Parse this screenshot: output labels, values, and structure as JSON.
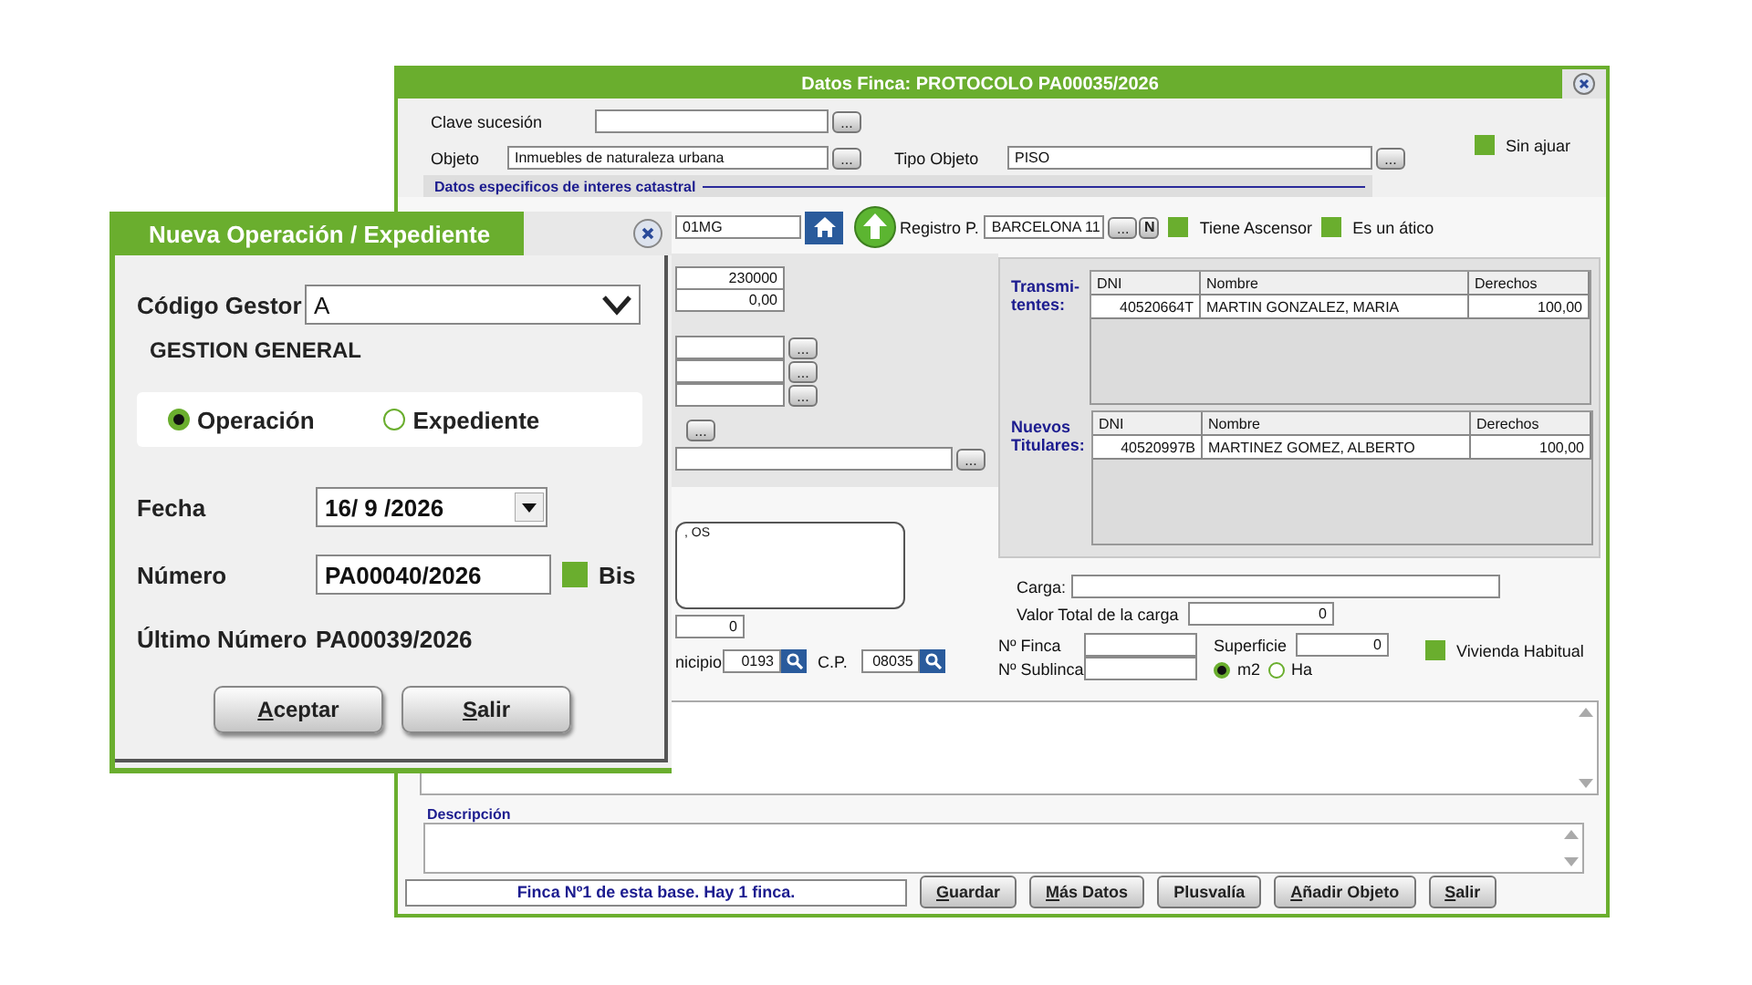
{
  "main_window": {
    "title": "Datos Finca: PROTOCOLO PA00035/2026",
    "clave_sucesion": {
      "label": "Clave sucesión",
      "button": "..."
    },
    "objeto": {
      "label": "Objeto",
      "value": "Inmuebles de naturaleza urbana",
      "button": "..."
    },
    "tipo_objeto": {
      "label": "Tipo Objeto",
      "value": "PISO",
      "button": "..."
    },
    "sin_ajuar": {
      "label": "Sin ajuar",
      "checked": false
    },
    "section_title": "Datos especificos de interes catastral",
    "ref_catastral": {
      "value": "01MG"
    },
    "registro": {
      "label": "Registro P.",
      "value": "BARCELONA 11",
      "button": "...",
      "n_button": "N"
    },
    "checks": [
      {
        "label": "Tiene Ascensor",
        "checked": false
      },
      {
        "label": "Es un ático",
        "checked": false
      }
    ],
    "value_fields": [
      {
        "value": "230000"
      },
      {
        "value": "0,00"
      }
    ],
    "lookup_fields": [
      {
        "button": "..."
      },
      {
        "button": "..."
      },
      {
        "button": "..."
      }
    ],
    "lone_button": "...",
    "long_field": {
      "button": "..."
    },
    "notes_text": ", OS",
    "amount_field": {
      "value": "0"
    },
    "municipio": {
      "label": "nicipio",
      "value": "0193"
    },
    "cp": {
      "label": "C.P.",
      "value": "08035"
    },
    "tables": [
      {
        "label": "Transmi-tentes:",
        "columns": [
          "DNI",
          "Nombre",
          "Derechos"
        ],
        "rows": [
          [
            "40520664T",
            "MARTIN GONZALEZ, MARIA",
            "100,00"
          ]
        ]
      },
      {
        "label": "Nuevos Titulares:",
        "columns": [
          "DNI",
          "Nombre",
          "Derechos"
        ],
        "rows": [
          [
            "40520997B",
            "MARTINEZ GOMEZ, ALBERTO",
            "100,00"
          ]
        ]
      }
    ],
    "carga": {
      "label": "Carga:"
    },
    "valor_total": {
      "label": "Valor Total de la carga",
      "value": "0"
    },
    "finca": {
      "label": "Nº Finca"
    },
    "subfinca": {
      "label": "Nº Sublinca"
    },
    "superficie": {
      "label": "Superficie",
      "value": "0"
    },
    "units": [
      {
        "label": "m2",
        "selected": true
      },
      {
        "label": "Ha",
        "selected": false
      }
    ],
    "vivienda": {
      "label": "Vivienda Habitual",
      "checked": false
    },
    "descripcion": {
      "label": "Descripción"
    },
    "status": "Finca Nº1 de esta base. Hay 1 finca.",
    "buttons": [
      {
        "label": "Guardar",
        "mnemonic": true
      },
      {
        "label": "Más Datos",
        "mnemonic": true
      },
      {
        "label": "Plusvalía",
        "mnemonic": false
      },
      {
        "label": "Añadir Objeto",
        "mnemonic": true
      },
      {
        "label": "Salir",
        "mnemonic": true
      }
    ]
  },
  "dialog": {
    "title": "Nueva Operación / Expediente",
    "codigo": {
      "label": "Código Gestor",
      "value": "A"
    },
    "gestor_name": "GESTION GENERAL",
    "options": [
      {
        "label": "Operación",
        "selected": true
      },
      {
        "label": "Expediente",
        "selected": false
      }
    ],
    "fecha": {
      "label": "Fecha",
      "value": "16/ 9 /2026"
    },
    "numero": {
      "label": "Número",
      "value": "PA00040/2026"
    },
    "bis": {
      "label": "Bis",
      "checked": false
    },
    "ultimo": {
      "label": "Último Número",
      "value": "PA00039/2026"
    },
    "buttons": [
      {
        "label": "Aceptar",
        "mnemonic": true
      },
      {
        "label": "Salir",
        "mnemonic": true
      }
    ]
  }
}
